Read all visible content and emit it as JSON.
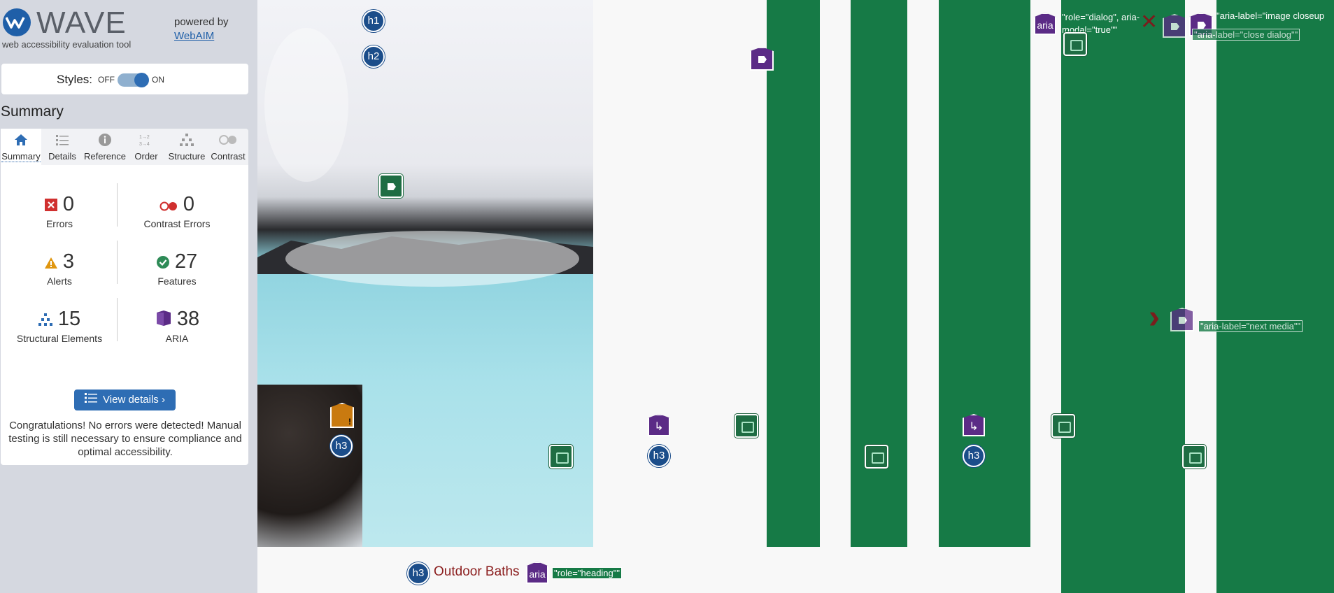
{
  "app": {
    "logo_text": "WAVE",
    "tagline": "web accessibility evaluation tool",
    "powered_by": "powered by",
    "webaim_link": "WebAIM"
  },
  "styles": {
    "label": "Styles:",
    "off": "OFF",
    "on": "ON",
    "state": "on"
  },
  "summary_title": "Summary",
  "tabs": [
    {
      "label": "Summary",
      "icon": "home-icon",
      "active": true
    },
    {
      "label": "Details",
      "icon": "list-icon",
      "active": false
    },
    {
      "label": "Reference",
      "icon": "info-icon",
      "active": false
    },
    {
      "label": "Order",
      "icon": "order-icon",
      "active": false
    },
    {
      "label": "Structure",
      "icon": "structure-icon",
      "active": false
    },
    {
      "label": "Contrast",
      "icon": "contrast-icon",
      "active": false
    }
  ],
  "stats": {
    "errors": {
      "value": "0",
      "label": "Errors",
      "color": "#d0302f"
    },
    "contrast_errors": {
      "value": "0",
      "label": "Contrast Errors",
      "color": "#d0302f"
    },
    "alerts": {
      "value": "3",
      "label": "Alerts",
      "color": "#e0960f"
    },
    "features": {
      "value": "27",
      "label": "Features",
      "color": "#2e8b57"
    },
    "structural": {
      "value": "15",
      "label": "Structural Elements",
      "color": "#2e6db4"
    },
    "aria": {
      "value": "38",
      "label": "ARIA",
      "color": "#5b2b86"
    }
  },
  "view_details": "View details ›",
  "congrats": "Congratulations! No errors were detected! Manual testing is still necessary to ensure compliance and optimal accessibility.",
  "page": {
    "badges": {
      "h1": "h1",
      "h2": "h2",
      "h3": "h3",
      "aria": "aria"
    },
    "dialog_role": "\"role=\"dialog\", aria-modal=\"true\"\"",
    "image_closeup": "\"aria-label=\"image closeup",
    "close_dialog": "\"aria-label=\"close dialog\"\"",
    "next_media": "\"aria-label=\"next media\"\"",
    "heading_role": "\"role=\"heading\"\"",
    "outdoor_baths": "Outdoor Baths"
  }
}
